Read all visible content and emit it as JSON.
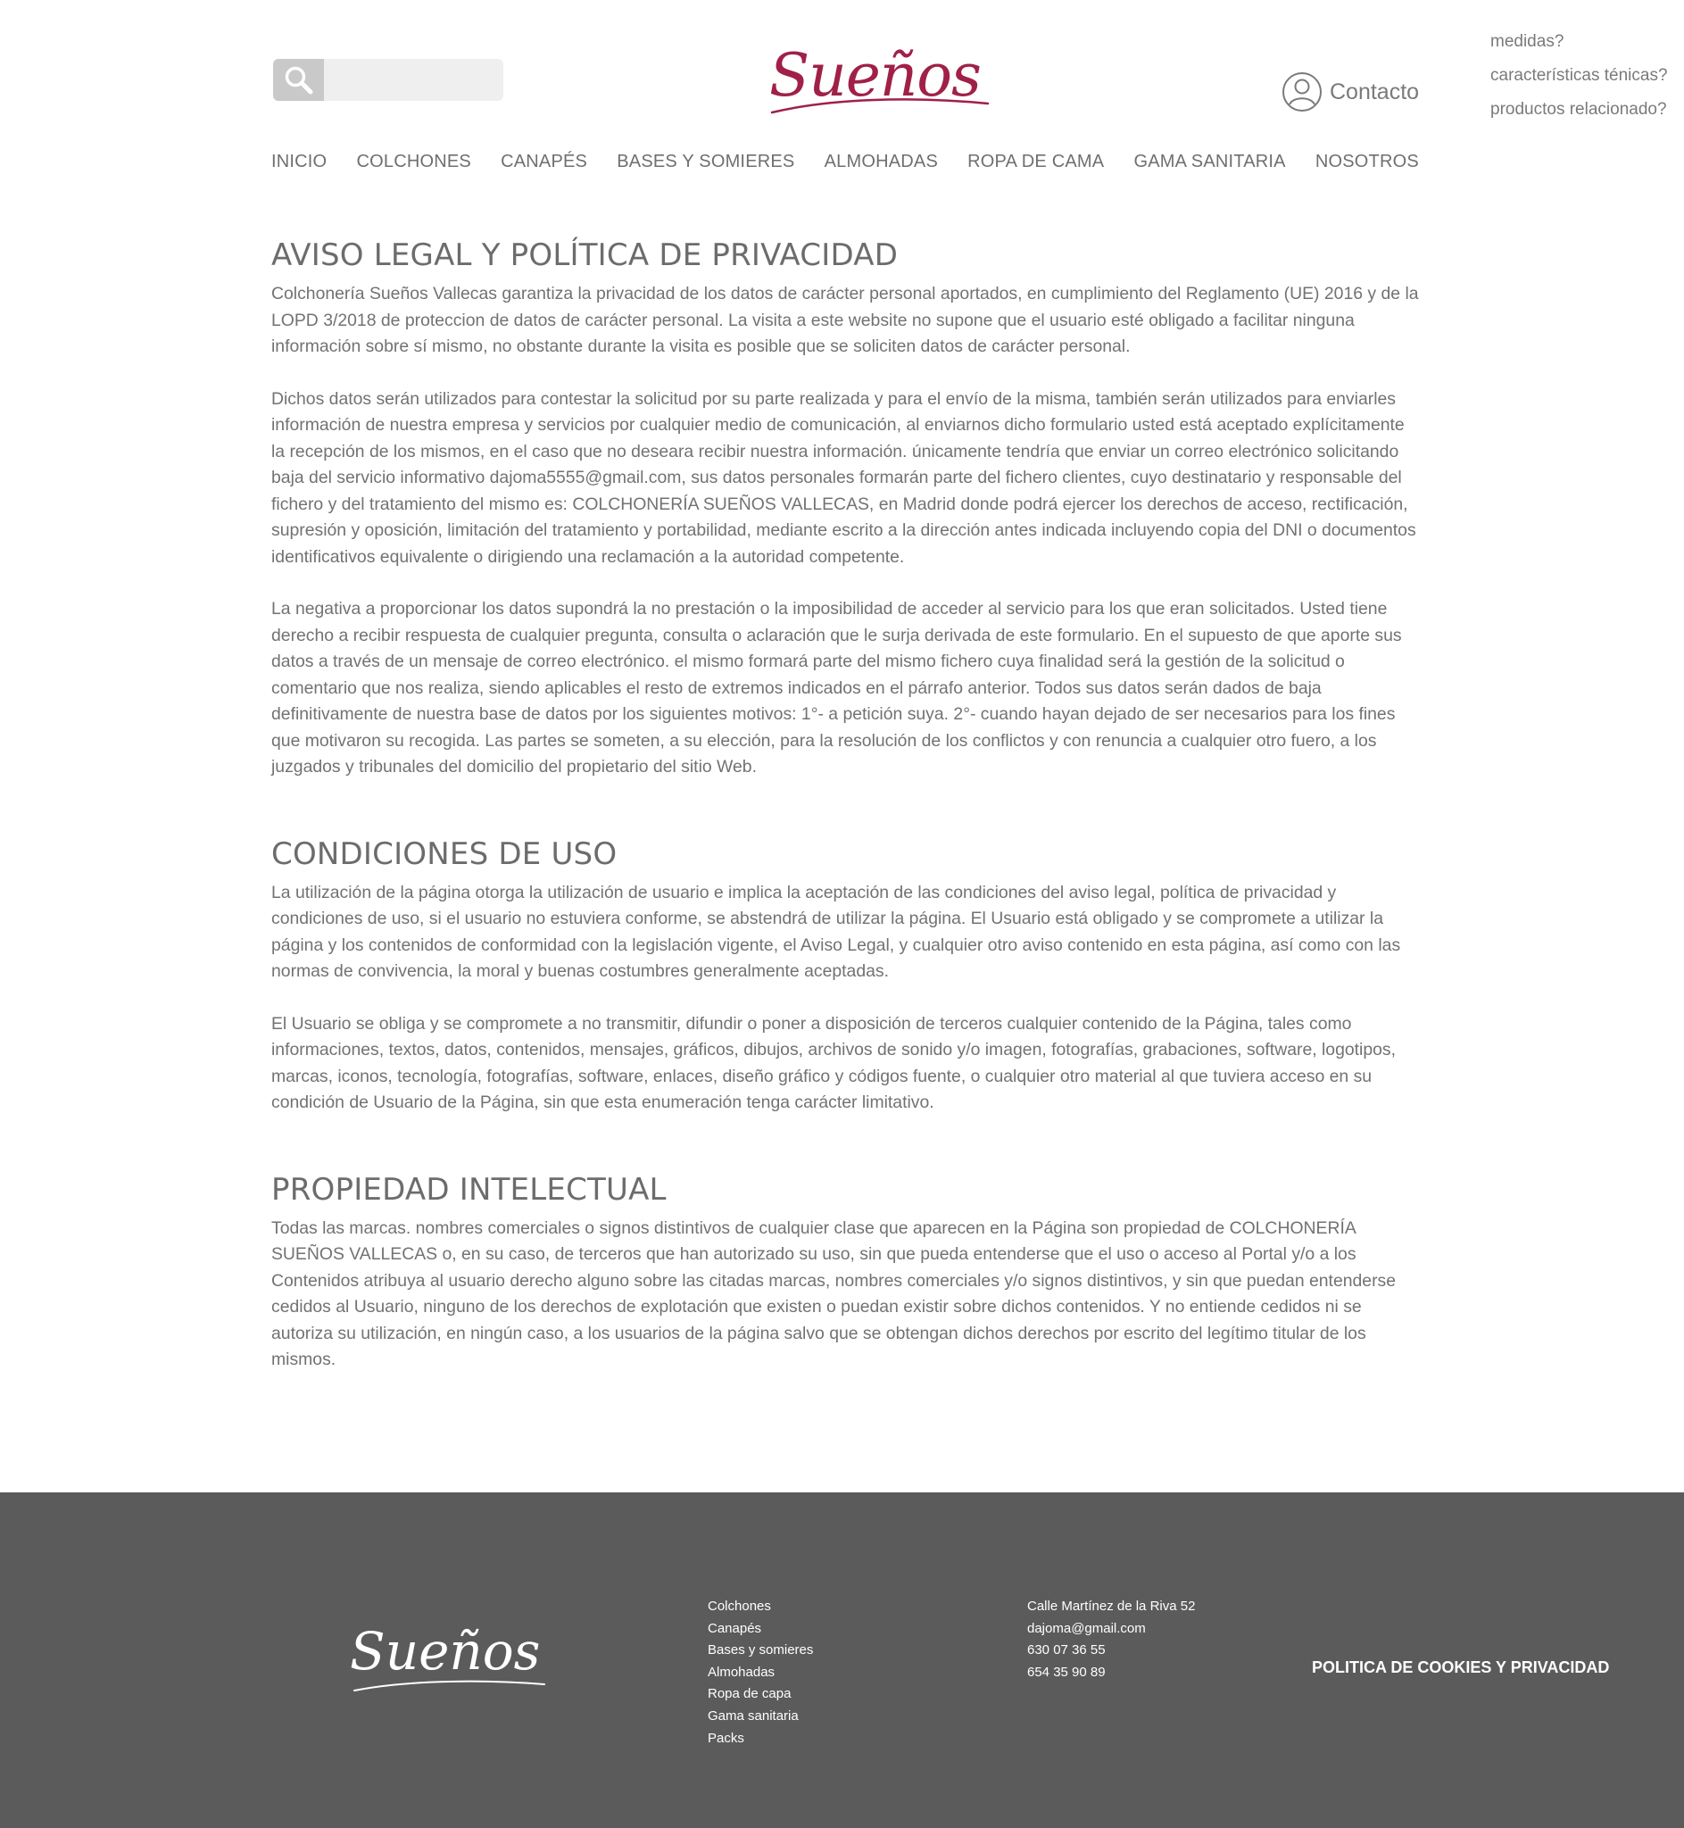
{
  "header": {
    "search": {
      "placeholder": ""
    },
    "logo": "Sueños",
    "contact_label": "Contacto"
  },
  "side_links": [
    "medidas?",
    "características ténicas?",
    "productos relacionado?"
  ],
  "nav": [
    "INICIO",
    "COLCHONES",
    "CANAPÉS",
    "BASES Y SOMIERES",
    "ALMOHADAS",
    "ROPA DE CAMA",
    "GAMA SANITARIA",
    "NOSOTROS"
  ],
  "sections": [
    {
      "title": "AVISO LEGAL Y POLÍTICA DE PRIVACIDAD",
      "paragraphs": [
        "Colchonería Sueños Vallecas garantiza la privacidad de los datos de carácter personal aportados, en cumplimiento del Reglamento (UE) 2016 y de la LOPD 3/2018 de proteccion de datos de carácter personal. La visita a este website no supone que el usuario esté obligado a facilitar ninguna información sobre sí mismo, no obstante durante la visita es posible que se soliciten datos de carácter personal.",
        "Dichos datos serán utilizados para contestar la solicitud por su parte realizada y para el envío de la misma, también serán utilizados para enviarles información de nuestra empresa y servicios por cualquier medio de comunicación, al enviarnos dicho formulario usted está aceptado explícitamente la recepción de los mismos, en el caso que no deseara recibir nuestra información. únicamente tendría que enviar un correo electrónico solicitando baja del servicio informativo dajoma5555@gmail.com, sus datos personales formarán parte del fichero clientes, cuyo destinatario y responsable del fichero y del tratamiento del mismo es: COLCHONERÍA SUEÑOS VALLECAS, en Madrid donde podrá ejercer los derechos de acceso, rectificación, supresión y oposición, limitación del tratamiento y portabilidad, mediante escrito a la dirección antes indicada incluyendo copia del DNI o documentos identificativos equivalente o dirigiendo una reclamación a la autoridad competente.",
        "La negativa a proporcionar los datos supondrá la no prestación o la imposibilidad de acceder al servicio para los que eran solicitados. Usted tiene derecho a recibir respuesta de cualquier pregunta, consulta o aclaración que le surja derivada de este formulario. En el supuesto de que aporte sus datos a través de un mensaje de correo electrónico. el mismo formará parte del mismo fichero cuya finalidad será la gestión de la solicitud o comentario que nos realiza, siendo aplicables el resto de extremos indicados en el párrafo anterior. Todos sus datos serán dados de baja definitivamente de nuestra base de datos por los siguientes motivos: 1°- a petición suya. 2°- cuando hayan dejado de ser necesarios para los fines que motivaron su recogida. Las partes se someten, a su elección, para la resolución de los conflictos y con renuncia a cualquier otro fuero, a los juzgados y tribunales del domicilio del propietario del sitio Web."
      ]
    },
    {
      "title": "CONDICIONES DE USO",
      "paragraphs": [
        "La utilización de la página otorga la utilización de usuario e implica la aceptación de las condiciones del aviso legal, política de privacidad y condiciones de uso, si el usuario no estuviera conforme, se abstendrá de utilizar la página. El Usuario está obligado y se compromete a utilizar la página y los contenidos de conformidad con la legislación vigente, el Aviso Legal, y cualquier otro aviso contenido en esta página, así como con las normas de convivencia, la moral y buenas costumbres generalmente aceptadas.",
        "El Usuario se obliga y se compromete a no transmitir, difundir o poner a disposición de terceros cualquier contenido de la Página, tales como informaciones, textos, datos, contenidos, mensajes, gráficos, dibujos, archivos de sonido y/o imagen, fotografías, grabaciones, software, logotipos, marcas, iconos, tecnología, fotografías, software, enlaces, diseño gráfico y códigos fuente, o cualquier otro material al que tuviera acceso en su condición de Usuario de la Página, sin que esta enumeración tenga carácter limitativo."
      ]
    },
    {
      "title": "PROPIEDAD INTELECTUAL",
      "paragraphs": [
        "Todas las marcas. nombres comerciales o signos distintivos de cualquier clase que aparecen en la Página son propiedad de COLCHONERÍA SUEÑOS VALLECAS o, en su caso, de terceros que han autorizado su uso, sin que pueda entenderse que el uso o acceso al Portal y/o a los Contenidos atribuya al usuario derecho alguno sobre las citadas marcas, nombres comerciales y/o signos distintivos, y sin que puedan entenderse cedidos al Usuario, ninguno de los derechos de explotación que existen o puedan existir sobre dichos contenidos. Y no entiende cedidos ni se autoriza su utilización, en ningún caso, a los usuarios de la página salvo que se obtengan dichos derechos por escrito del legítimo titular de los mismos."
      ]
    }
  ],
  "footer": {
    "logo": "Sueños",
    "links": [
      "Colchones",
      "Canapés",
      "Bases y somieres",
      "Almohadas",
      "Ropa de capa",
      "Gama sanitaria",
      "Packs"
    ],
    "contact": [
      "Calle Martínez de la Riva 52",
      "dajoma@gmail.com",
      "630 07 36 55",
      "654 35 90 89"
    ],
    "policy_link": "POLITICA DE COOKIES Y PRIVACIDAD"
  },
  "colors": {
    "brand": "#a02048",
    "text": "#727272",
    "footer_bg": "#5b5b5b",
    "search_bg": "#efefef",
    "search_button_bg": "#c9c9c9"
  }
}
